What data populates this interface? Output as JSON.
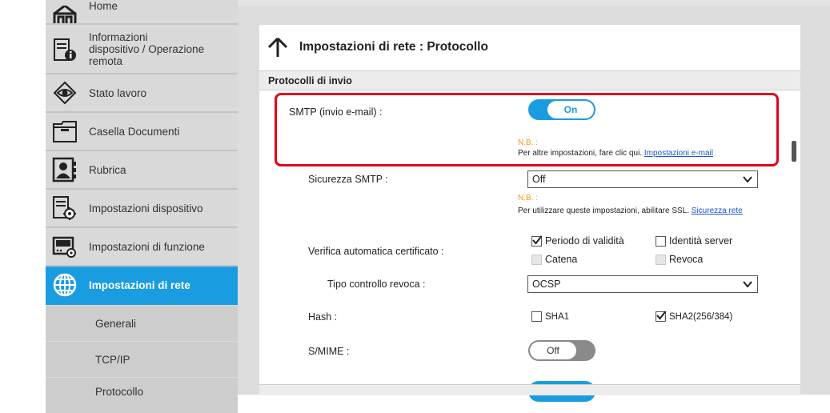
{
  "sidebar": {
    "items": [
      {
        "label": "Home",
        "icon": "home-icon"
      },
      {
        "label": "Informazioni\ndispositivo / Operazione\nremota",
        "icon": "device-info-icon"
      },
      {
        "label": "Stato lavoro",
        "icon": "eye-icon"
      },
      {
        "label": "Casella Documenti",
        "icon": "folder-icon"
      },
      {
        "label": "Rubrica",
        "icon": "address-book-icon"
      },
      {
        "label": "Impostazioni dispositivo",
        "icon": "device-settings-icon"
      },
      {
        "label": "Impostazioni di funzione",
        "icon": "function-settings-icon"
      },
      {
        "label": "Impostazioni di rete",
        "icon": "globe-icon",
        "active": true
      }
    ],
    "subitems": [
      "Generali",
      "TCP/IP",
      "Protocollo"
    ]
  },
  "page": {
    "title": "Impostazioni di rete : Protocollo",
    "section": "Protocolli di invio"
  },
  "smtp": {
    "label": "SMTP (invio e-mail) :",
    "toggle": "On",
    "note_tag": "N.B. :",
    "note_text": "Per altre impostazioni, fare clic qui.",
    "note_link": "Impostazioni e-mail"
  },
  "smtp_security": {
    "label": "Sicurezza SMTP :",
    "value": "Off",
    "note_tag": "N.B. :",
    "note_text": "Per utilizzare queste impostazioni, abilitare SSL.",
    "note_link": "Sicurezza rete"
  },
  "cert_check": {
    "label": "Verifica automatica certificato :",
    "options": [
      {
        "label": "Periodo di validità",
        "checked": true,
        "disabled": false
      },
      {
        "label": "Identità server",
        "checked": false,
        "disabled": false
      },
      {
        "label": "Catena",
        "checked": false,
        "disabled": true
      },
      {
        "label": "Revoca",
        "checked": false,
        "disabled": true
      }
    ]
  },
  "revocation": {
    "label": "Tipo controllo revoca :",
    "value": "OCSP"
  },
  "hash": {
    "label": "Hash :",
    "options": [
      {
        "label": "SHA1",
        "checked": false
      },
      {
        "label": "SHA2(256/384)",
        "checked": true
      }
    ]
  },
  "smime": {
    "label": "S/MIME :",
    "toggle": "Off"
  },
  "colors": {
    "accent": "#1a9de0",
    "highlight": "#e5001a",
    "note": "#f39c12",
    "link": "#1a55cc"
  }
}
